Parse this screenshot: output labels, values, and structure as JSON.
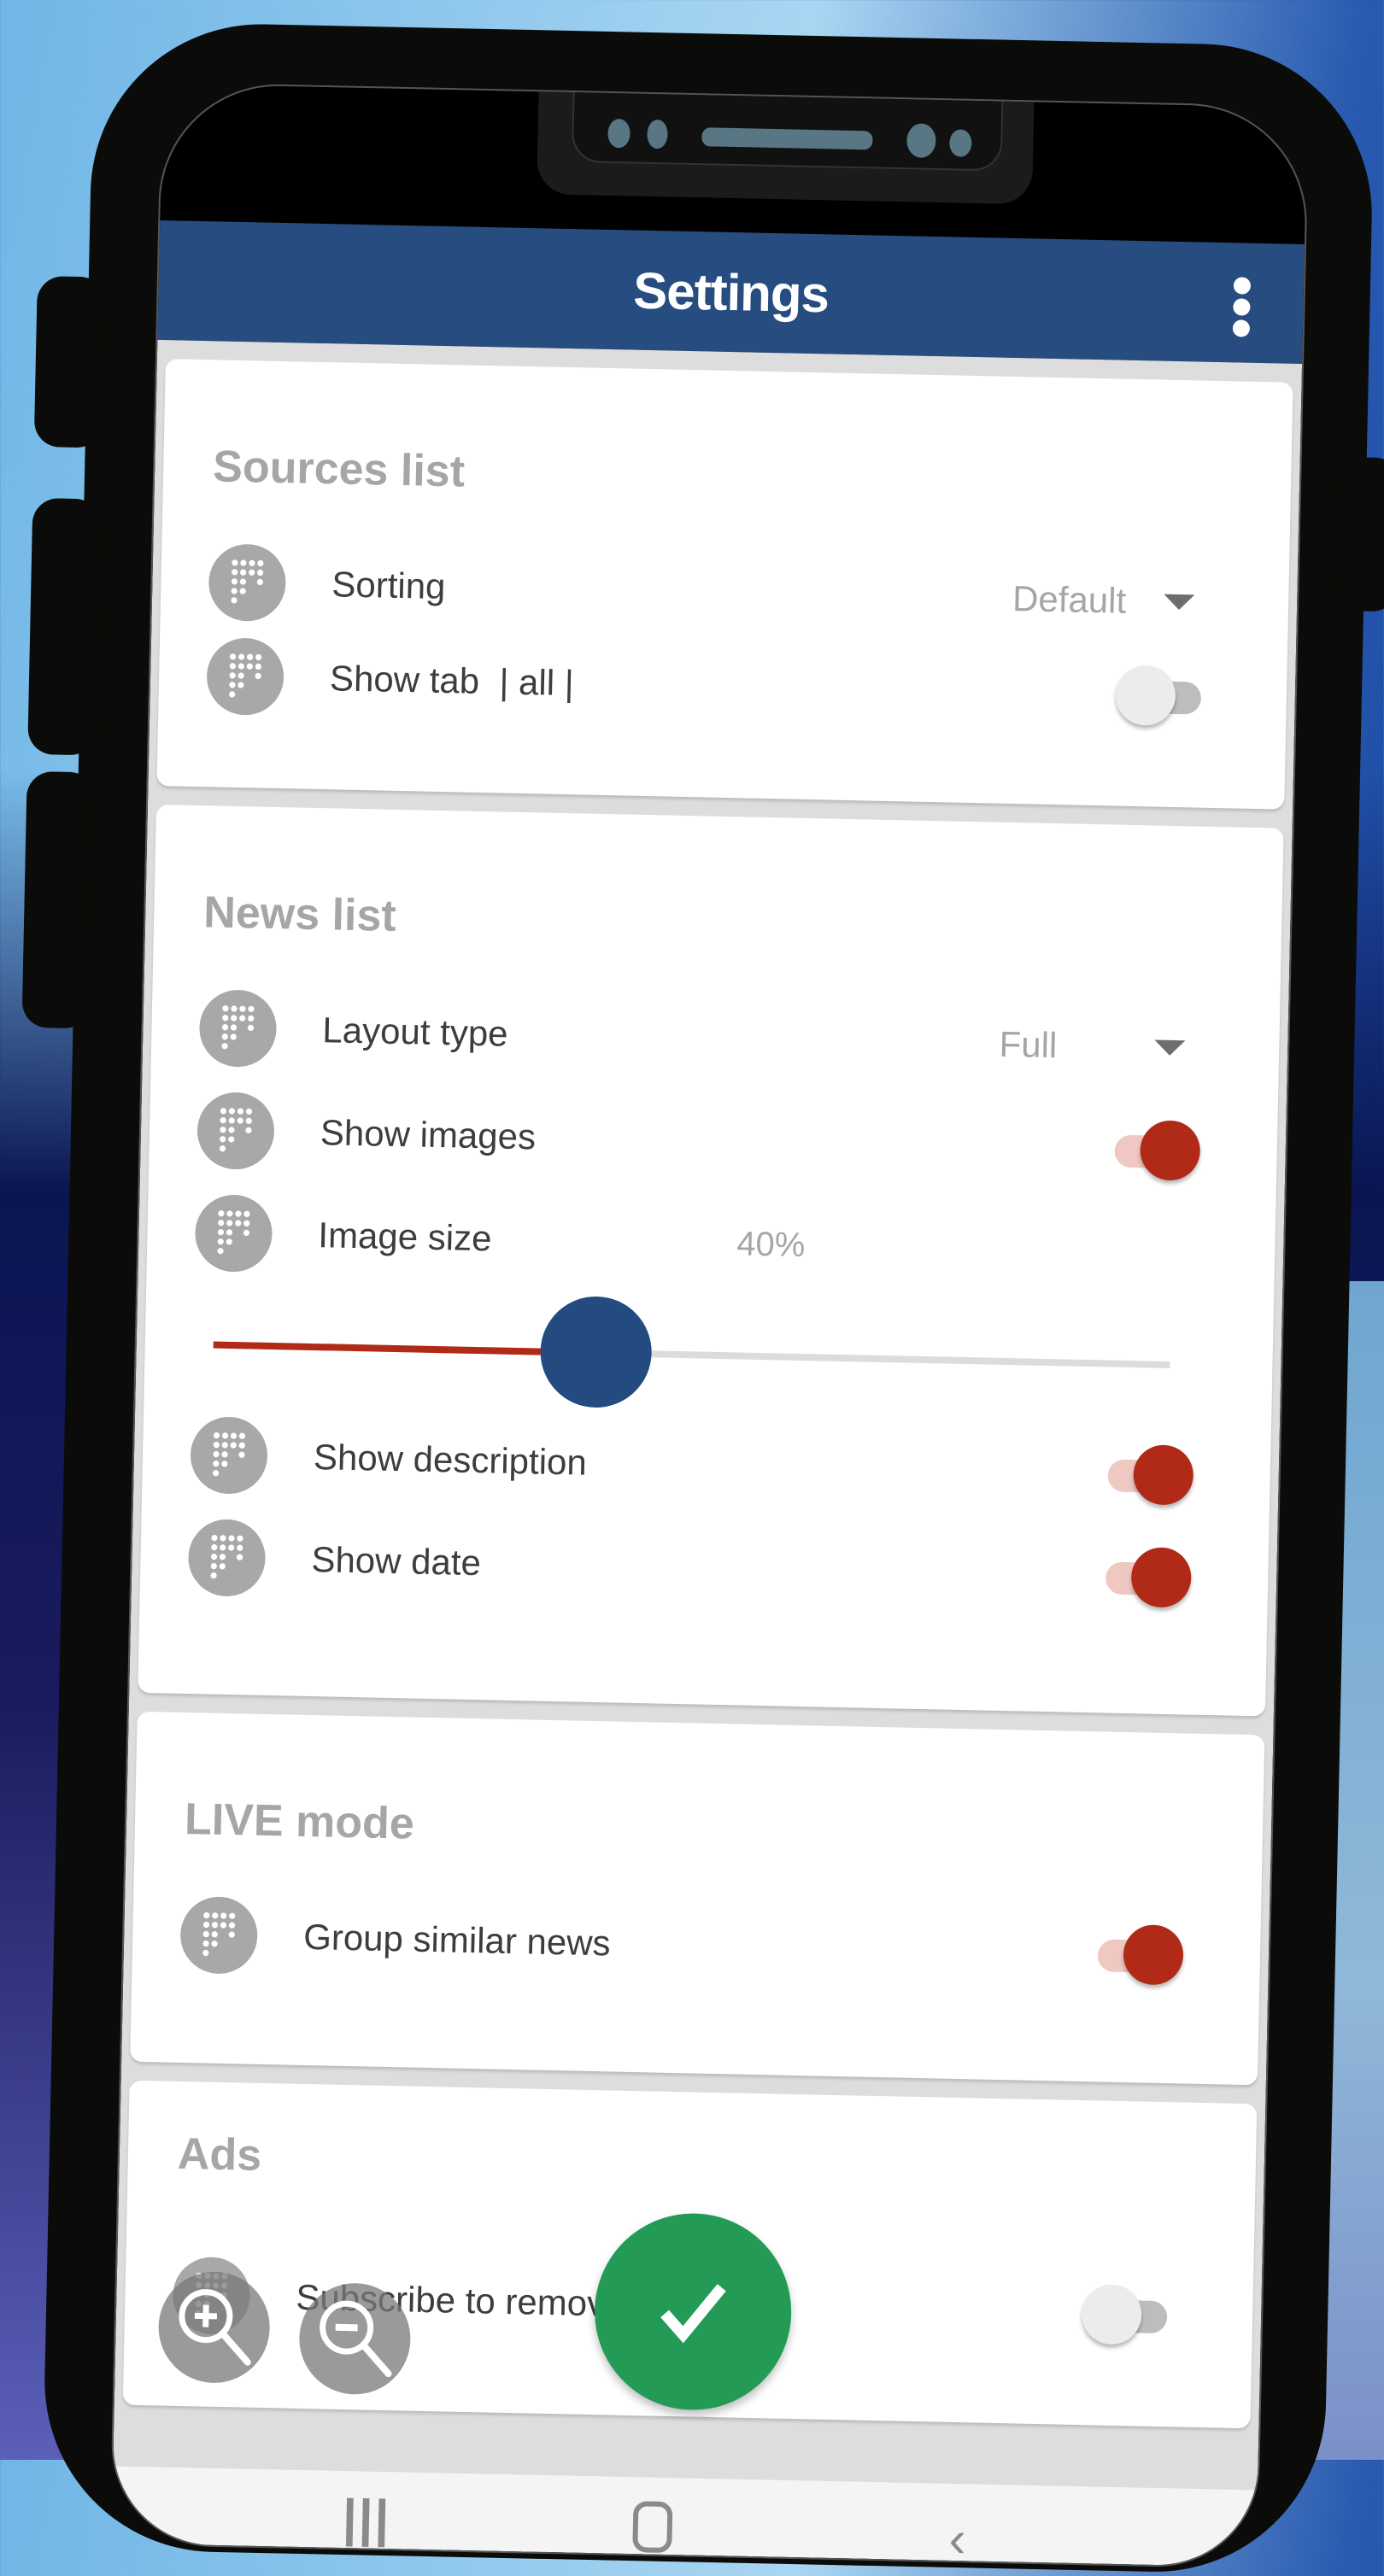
{
  "app": {
    "title": "Settings",
    "menu_icon": "more-vert-icon",
    "colors": {
      "appbar": "#264c80",
      "toggle_on": "#b12a17",
      "toggle_on_track": "#efc8c2",
      "slider_thumb": "#234b80",
      "fab": "#239a56",
      "section_title": "#a6a6a6"
    }
  },
  "sections": {
    "sources": {
      "title": "Sources list",
      "sorting": {
        "label": "Sorting",
        "value": "Default",
        "icon": "dot-matrix-icon"
      },
      "show_tab": {
        "label": "Show tab  | all |",
        "enabled": false,
        "icon": "dot-matrix-icon"
      }
    },
    "news": {
      "title": "News list",
      "layout_type": {
        "label": "Layout type",
        "value": "Full",
        "icon": "dot-matrix-icon"
      },
      "show_images": {
        "label": "Show images",
        "enabled": true,
        "icon": "dot-matrix-icon"
      },
      "image_size": {
        "label": "Image size",
        "value_text": "40%",
        "value": 40,
        "min": 0,
        "max": 100,
        "icon": "dot-matrix-icon"
      },
      "show_description": {
        "label": "Show description",
        "enabled": true,
        "icon": "dot-matrix-icon"
      },
      "show_date": {
        "label": "Show date",
        "enabled": true,
        "icon": "dot-matrix-icon"
      }
    },
    "live": {
      "title": "LIVE mode",
      "group_similar": {
        "label": "Group similar news",
        "enabled": true,
        "icon": "dot-matrix-icon"
      }
    },
    "ads": {
      "title": "Ads",
      "subscribe": {
        "label": "Subscribe to remove our ads",
        "enabled": false,
        "icon": "dot-matrix-icon"
      }
    }
  },
  "floating": {
    "zoom_in": "zoom-in-icon",
    "zoom_out": "zoom-out-icon",
    "confirm": "check-icon"
  },
  "navbar": {
    "recents": "|||",
    "home": "home-icon",
    "back": "back-icon"
  }
}
